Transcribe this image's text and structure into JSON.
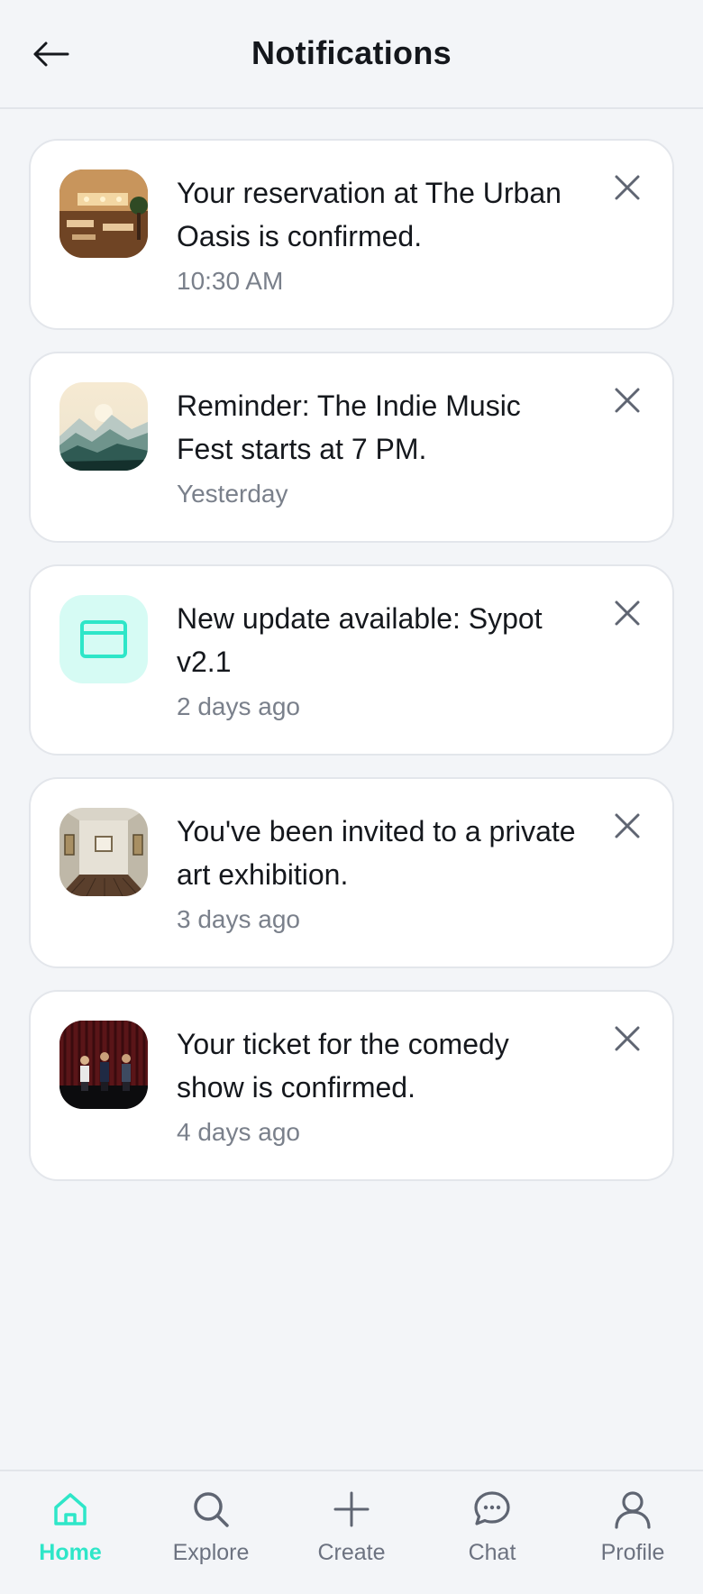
{
  "header": {
    "title": "Notifications",
    "back_icon": "arrow-left-icon"
  },
  "notifications": [
    {
      "message": "Your reservation at The Urban Oasis is confirmed.",
      "time": "10:30 AM",
      "thumb": "restaurant-photo"
    },
    {
      "message": "Reminder: The Indie Music Fest starts at 7 PM.",
      "time": "Yesterday",
      "thumb": "mountain-landscape"
    },
    {
      "message": "New update available: Sypot v2.1",
      "time": "2 days ago",
      "thumb": "app-window-icon"
    },
    {
      "message": "You've been invited to a private art exhibition.",
      "time": "3 days ago",
      "thumb": "art-gallery-photo"
    },
    {
      "message": "Your ticket for the comedy show is confirmed.",
      "time": "4 days ago",
      "thumb": "comedy-stage-photo"
    }
  ],
  "tabs": [
    {
      "label": "Home",
      "icon": "home-icon",
      "active": true
    },
    {
      "label": "Explore",
      "icon": "search-icon",
      "active": false
    },
    {
      "label": "Create",
      "icon": "plus-icon",
      "active": false
    },
    {
      "label": "Chat",
      "icon": "chat-bubble-icon",
      "active": false
    },
    {
      "label": "Profile",
      "icon": "user-icon",
      "active": false
    }
  ],
  "colors": {
    "accent": "#2ee6c8",
    "background": "#f3f5f8",
    "card": "#ffffff",
    "muted_text": "#7a808b"
  }
}
